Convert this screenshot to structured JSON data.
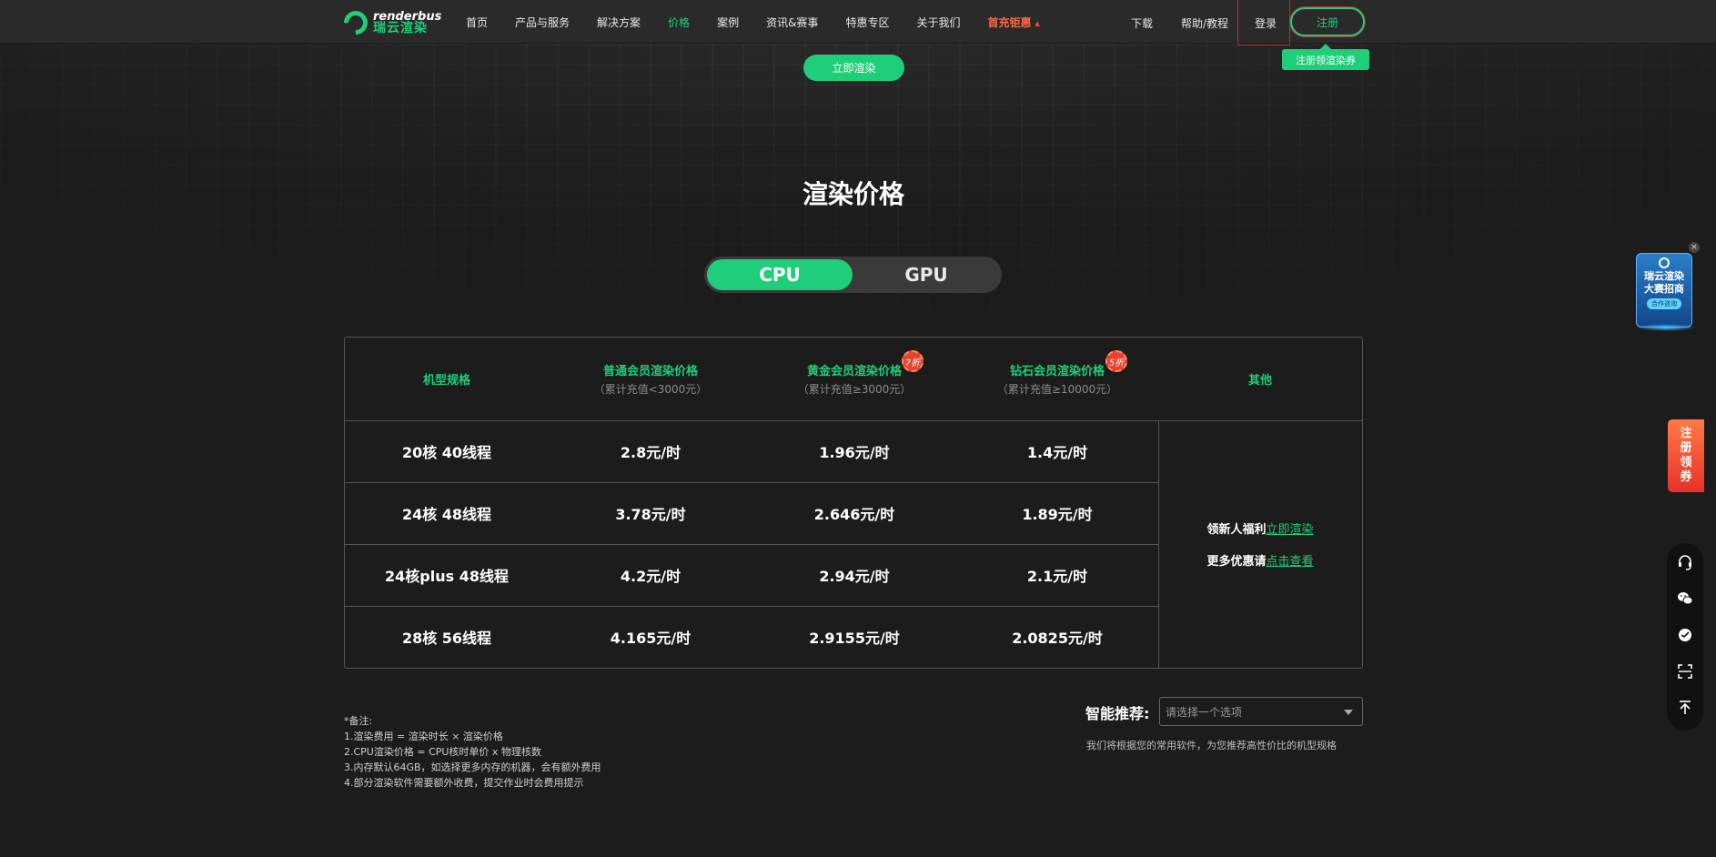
{
  "header": {
    "logo_en": "renderbus",
    "logo_cn": "瑞云渲染",
    "nav": [
      {
        "label": "首页",
        "state": "normal"
      },
      {
        "label": "产品与服务",
        "state": "normal"
      },
      {
        "label": "解决方案",
        "state": "normal"
      },
      {
        "label": "价格",
        "state": "active"
      },
      {
        "label": "案例",
        "state": "normal"
      },
      {
        "label": "资讯&赛事",
        "state": "normal"
      },
      {
        "label": "特惠专区",
        "state": "normal"
      },
      {
        "label": "关于我们",
        "state": "normal"
      },
      {
        "label": "首充钜惠",
        "state": "hot"
      }
    ],
    "download": "下载",
    "help": "帮助/教程",
    "login": "登录",
    "register": "注册",
    "coupon_tip": "注册领渲染券"
  },
  "hero": {
    "render_now": "立即渲染",
    "title": "渲染价格"
  },
  "switch": {
    "cpu": "CPU",
    "gpu": "GPU",
    "selected": "CPU"
  },
  "table": {
    "headers": [
      {
        "main": "机型规格",
        "sub": "",
        "badge": ""
      },
      {
        "main": "普通会员渲染价格",
        "sub": "（累计充值<3000元）",
        "badge": ""
      },
      {
        "main": "黄金会员渲染价格",
        "sub": "（累计充值≥3000元）",
        "badge": "7折"
      },
      {
        "main": "钻石会员渲染价格",
        "sub": "（累计充值≥10000元）",
        "badge": "5折"
      },
      {
        "main": "其他",
        "sub": "",
        "badge": ""
      }
    ],
    "rows": [
      {
        "spec": "20核 40线程",
        "normal": "2.8元/时",
        "gold": "1.96元/时",
        "diamond": "1.4元/时"
      },
      {
        "spec": "24核 48线程",
        "normal": "3.78元/时",
        "gold": "2.646元/时",
        "diamond": "1.89元/时"
      },
      {
        "spec": "24核plus 48线程",
        "normal": "4.2元/时",
        "gold": "2.94元/时",
        "diamond": "2.1元/时"
      },
      {
        "spec": "28核 56线程",
        "normal": "4.165元/时",
        "gold": "2.9155元/时",
        "diamond": "2.0825元/时"
      }
    ],
    "other": {
      "line1_prefix": "领新人福利",
      "line1_link": "立即渲染",
      "line2_prefix": "更多优惠请",
      "line2_link": "点击查看"
    }
  },
  "notes": {
    "title": "*备注:",
    "items": [
      "1.渲染费用 = 渲染时长 × 渲染价格",
      "2.CPU渲染价格 = CPU核时单价 x 物理核数",
      "3.内存默认64GB，如选择更多内存的机器，会有额外费用",
      "4.部分渲染软件需要额外收费，提交作业时会费用提示"
    ]
  },
  "recommend": {
    "label": "智能推荐:",
    "placeholder": "请选择一个选项",
    "hint": "我们将根据您的常用软件，为您推荐高性价比的机型规格"
  },
  "side": {
    "promo_line1": "瑞云渲染",
    "promo_line2": "大赛招商",
    "promo_btn": "合作咨询",
    "close": "×",
    "reg_coupon": [
      "注",
      "册",
      "领",
      "券"
    ],
    "tools": [
      "headset-icon",
      "wechat-icon",
      "chat-icon",
      "scan-icon",
      "back-to-top-icon"
    ]
  },
  "colors": {
    "accent": "#1fce79",
    "background": "#1c1c1c",
    "hot": "#ff6a3d",
    "badge": "#e8432d"
  }
}
